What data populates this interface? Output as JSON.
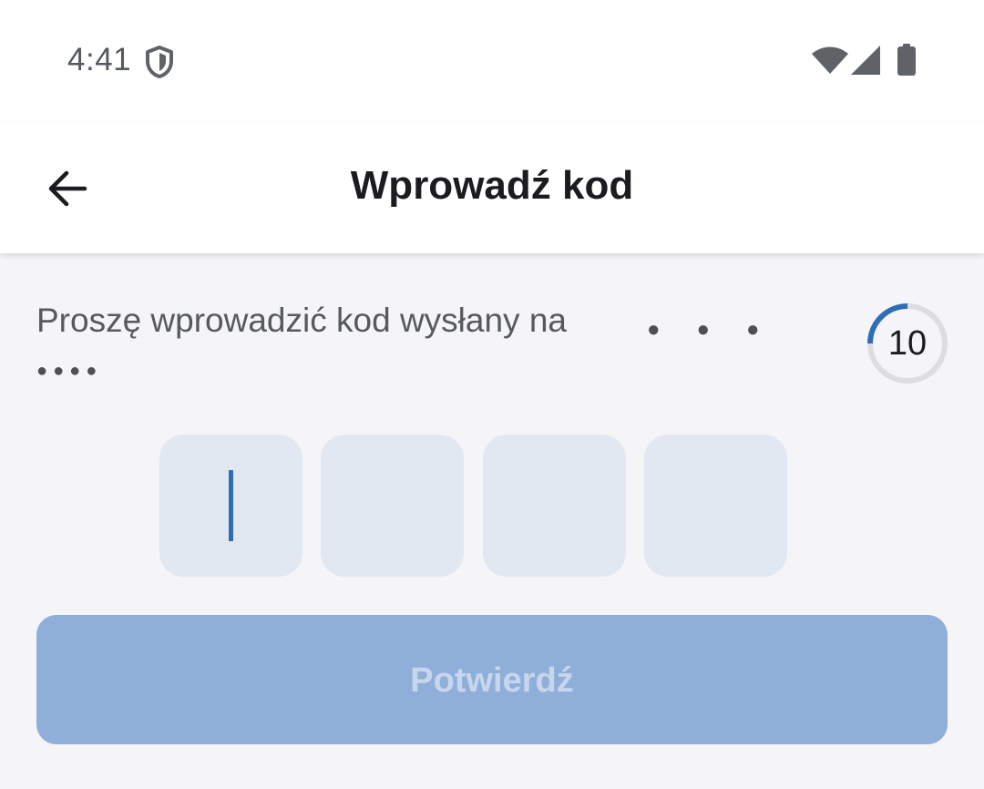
{
  "status_bar": {
    "time": "4:41",
    "icons": [
      "shield-icon",
      "wifi-icon",
      "signal-icon",
      "battery-icon"
    ]
  },
  "app_bar": {
    "back_icon": "arrow-left-icon",
    "title": "Wprowadź kod"
  },
  "instruction": {
    "text": "Proszę wprowadzić kod wysłany na",
    "masked_line_1": "●●●",
    "masked_line_2": "●●●●"
  },
  "timer": {
    "seconds": "10",
    "progress_fraction": 0.25
  },
  "code_input": {
    "digits": [
      "",
      "",
      "",
      ""
    ],
    "active_index": 0
  },
  "confirm_button": {
    "label": "Potwierdź",
    "enabled": false
  },
  "colors": {
    "accent": "#2f6db5",
    "code_box_bg": "#e2e8f1",
    "button_disabled_bg": "#8fafd8",
    "button_disabled_text": "#c6d7ed",
    "page_bg": "#f5f5f8"
  }
}
